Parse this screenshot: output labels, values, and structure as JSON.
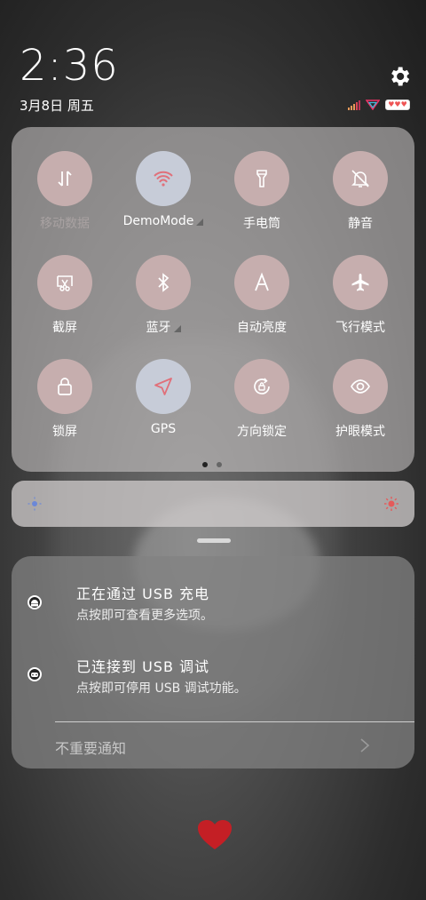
{
  "status": {
    "time": "2:36",
    "date": "3月8日 周五",
    "battery": "♥♥♥"
  },
  "tiles": [
    {
      "label": "移动数据",
      "icon": "mobile-data-icon",
      "active": false,
      "dim": true
    },
    {
      "label": "DemoMode",
      "icon": "wifi-icon",
      "active": true,
      "has_more": true
    },
    {
      "label": "手电筒",
      "icon": "flashlight-icon",
      "active": false
    },
    {
      "label": "静音",
      "icon": "mute-bell-icon",
      "active": false
    },
    {
      "label": "截屏",
      "icon": "screenshot-icon",
      "active": false
    },
    {
      "label": "蓝牙",
      "icon": "bluetooth-icon",
      "active": false,
      "has_more": true
    },
    {
      "label": "自动亮度",
      "icon": "auto-brightness-icon",
      "active": false
    },
    {
      "label": "飞行模式",
      "icon": "airplane-icon",
      "active": false
    },
    {
      "label": "锁屏",
      "icon": "lock-icon",
      "active": false
    },
    {
      "label": "GPS",
      "icon": "gps-icon",
      "active": true
    },
    {
      "label": "方向锁定",
      "icon": "rotation-lock-icon",
      "active": false
    },
    {
      "label": "护眼模式",
      "icon": "eye-icon",
      "active": false
    }
  ],
  "brightness": {
    "low_icon": "sun-dim-icon",
    "high_icon": "sun-bright-icon",
    "level": 0.0
  },
  "notifications": [
    {
      "title": "正在通过 USB 充电",
      "subtitle": "点按即可查看更多选项。",
      "icon": "android-icon"
    },
    {
      "title": "已连接到 USB 调试",
      "subtitle": "点按即可停用 USB 调试功能。",
      "icon": "android-debug-icon"
    }
  ],
  "unimportant_label": "不重要通知",
  "colors": {
    "tile_off": "#c6aeae",
    "tile_on": "#c7ccd8",
    "wifi_on": "#e0707a",
    "heart": "#c41f25"
  }
}
